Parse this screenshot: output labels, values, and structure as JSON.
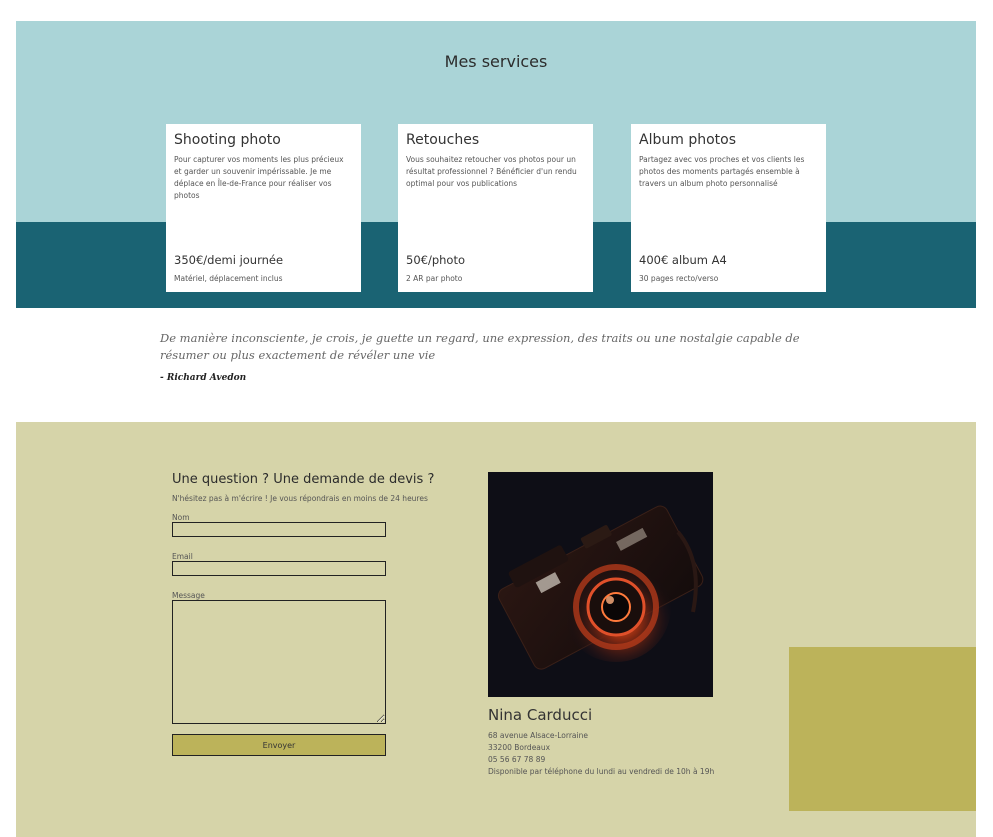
{
  "services": {
    "title": "Mes services",
    "cards": [
      {
        "title": "Shooting photo",
        "description": "Pour capturer vos moments les plus précieux et garder un souvenir impérissable. Je me déplace en Île-de-France pour réaliser vos photos",
        "price": "350€/demi journée",
        "note": "Matériel, déplacement inclus"
      },
      {
        "title": "Retouches",
        "description": "Vous souhaitez retoucher vos photos pour un résultat professionnel ? Bénéficier d'un rendu optimal pour vos publications",
        "price": "50€/photo",
        "note": "2 AR par photo"
      },
      {
        "title": "Album photos",
        "description": "Partagez avec vos proches et vos clients les photos des moments partagés ensemble à travers un album photo personnalisé",
        "price": "400€ album A4",
        "note": "30 pages recto/verso"
      }
    ]
  },
  "quote": {
    "text": "De manière inconsciente, je crois, je guette un regard, une expression, des traits ou une nostalgie capable de résumer ou plus exactement de révéler une vie",
    "author": "- Richard Avedon"
  },
  "contact": {
    "title": "Une question ? Une demande de devis ?",
    "subtitle": "N'hésitez pas à m'écrire ! Je vous répondrais en moins de 24 heures",
    "fields": {
      "name_label": "Nom",
      "name_value": "",
      "email_label": "Email",
      "email_value": "",
      "message_label": "Message",
      "message_value": ""
    },
    "submit_label": "Envoyer",
    "person": {
      "name": "Nina Carducci",
      "address": "68 avenue Alsace-Lorraine",
      "city": "33200 Bordeaux",
      "phone": "05 56 67 78 89",
      "availability": "Disponible par téléphone du lundi au vendredi de 10h à 19h"
    }
  },
  "colors": {
    "services_bg": "#aad4d7",
    "services_band": "#1a6373",
    "contact_bg": "#d6d4a9",
    "accent": "#bcb35a"
  }
}
